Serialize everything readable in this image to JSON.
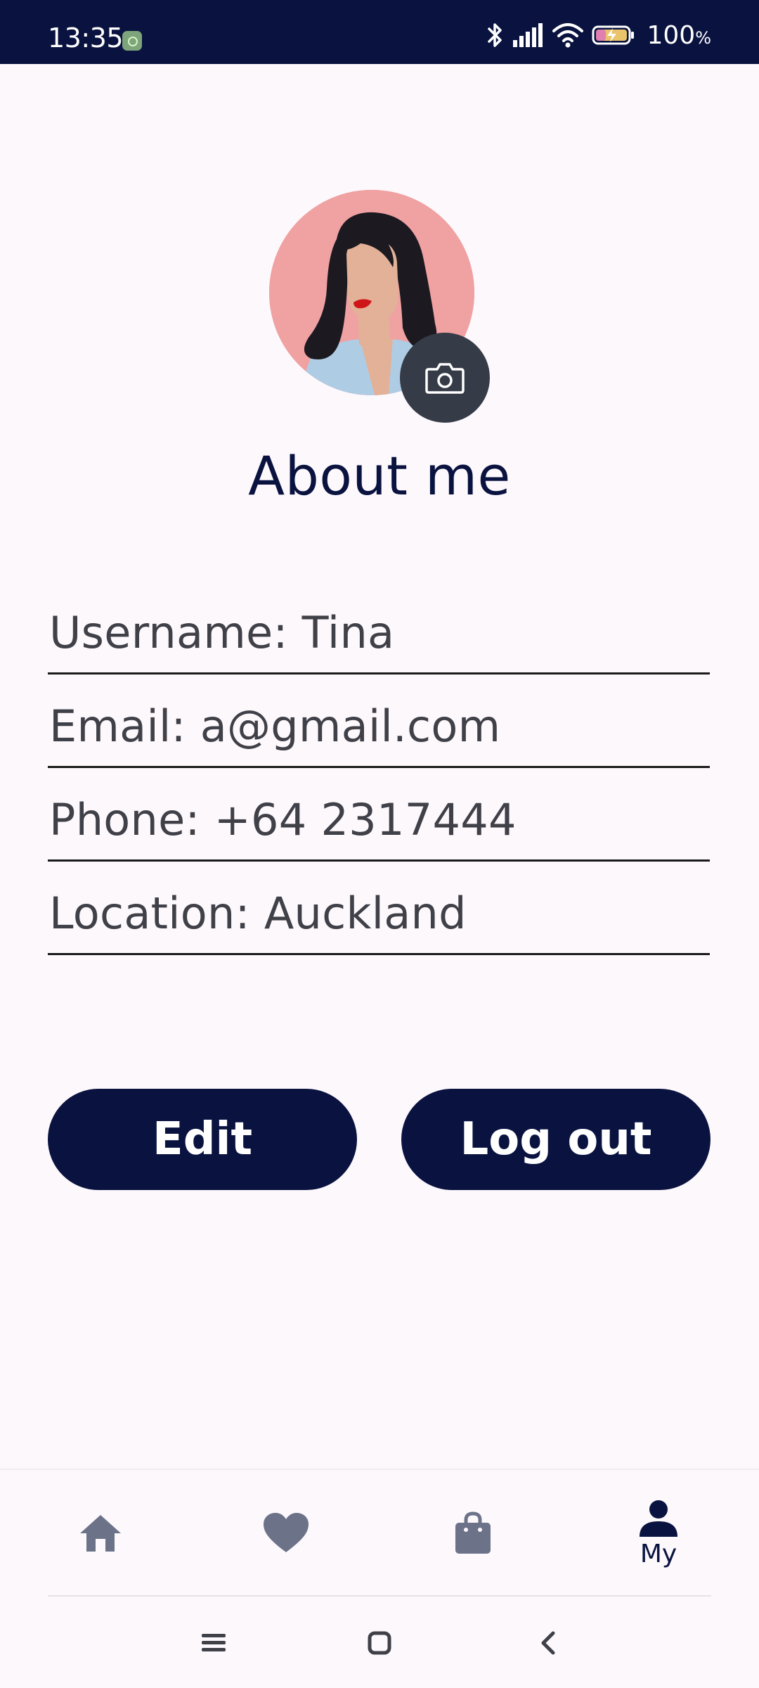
{
  "status_bar": {
    "time": "13:35",
    "battery_percent": "100",
    "battery_unit": "%",
    "background": "#0a1340"
  },
  "profile": {
    "title": "About me"
  },
  "fields": [
    {
      "label": "Username",
      "value": "Tina",
      "display": "Username: Tina"
    },
    {
      "label": "Email",
      "value": "a@gmail.com",
      "display": "Email: a@gmail.com"
    },
    {
      "label": "Phone",
      "value": "+64 2317444",
      "display": "Phone: +64 2317444"
    },
    {
      "label": "Location",
      "value": "Auckland",
      "display": "Location: Auckland"
    }
  ],
  "actions": {
    "edit_label": "Edit",
    "logout_label": "Log out"
  },
  "bottom_nav": {
    "items": [
      {
        "icon": "home-icon"
      },
      {
        "icon": "heart-icon"
      },
      {
        "icon": "shopping-bag-icon"
      },
      {
        "icon": "person-icon",
        "label": "My",
        "active": true
      }
    ]
  },
  "system_nav": {
    "icons": [
      "menu-icon",
      "home-square-icon",
      "back-icon"
    ]
  },
  "colors": {
    "primary": "#0a1340",
    "nav_inactive": "#6c7389",
    "background": "#fdf8fc",
    "avatar_bg": "#f0a1a2"
  }
}
